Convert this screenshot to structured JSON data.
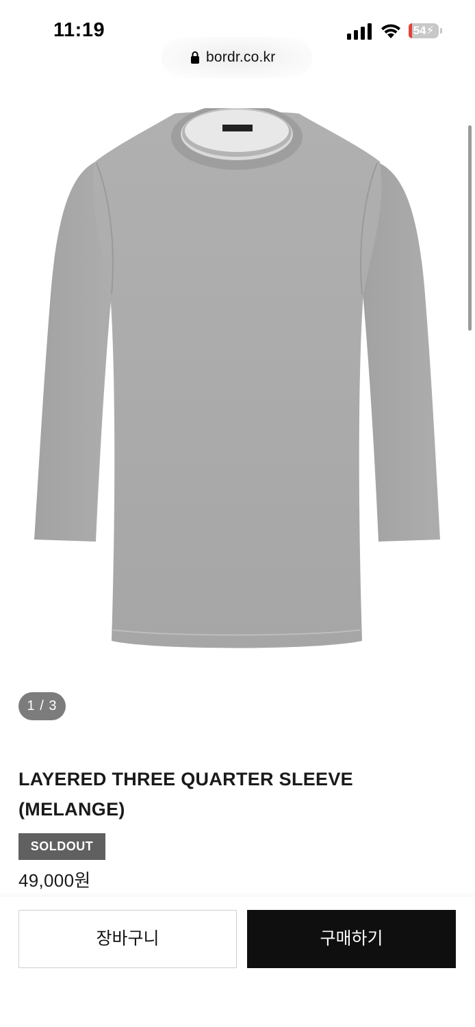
{
  "status_bar": {
    "time": "11:19",
    "battery": "54"
  },
  "browser": {
    "url": "bordr.co.kr"
  },
  "gallery": {
    "counter": "1 / 3",
    "image_description_icon": "gray-three-quarter-sleeve-tshirt"
  },
  "product": {
    "title_line1": "LAYERED THREE QUARTER SLEEVE",
    "title_line2": "(MELANGE)",
    "badge": "SOLDOUT",
    "price": "49,000원"
  },
  "actions": {
    "cart_label": "장바구니",
    "buy_label": "구매하기"
  },
  "colors": {
    "accent": "#0f0f0f",
    "badge_bg": "#606060",
    "shirt": "#a9a9a9"
  }
}
